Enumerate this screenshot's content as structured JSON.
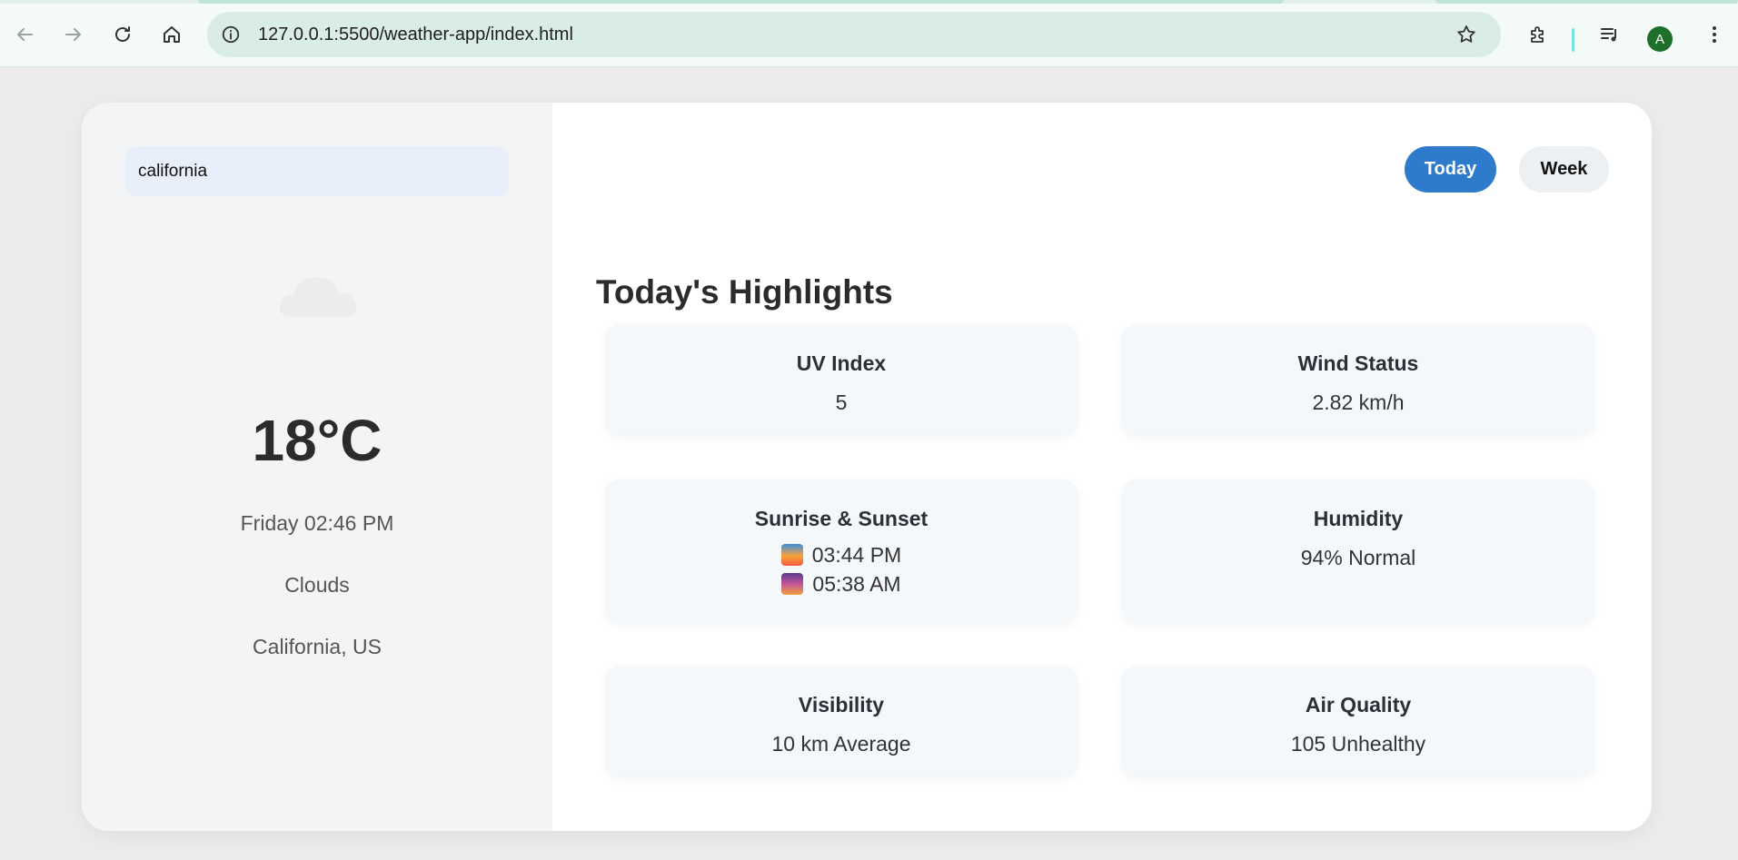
{
  "browser": {
    "url": "127.0.0.1:5500/weather-app/index.html",
    "avatar_letter": "A"
  },
  "sidebar": {
    "search_value": "california",
    "weather_icon": "cloud-icon",
    "temperature": "18°C",
    "datetime": "Friday 02:46 PM",
    "condition": "Clouds",
    "location": "California, US"
  },
  "toggles": {
    "today": "Today",
    "week": "Week"
  },
  "highlights": {
    "title": "Today's Highlights",
    "uv": {
      "label": "UV Index",
      "value": "5"
    },
    "wind": {
      "label": "Wind Status",
      "value": "2.82 km/h"
    },
    "sun": {
      "label": "Sunrise & Sunset",
      "sunrise": "03:44 PM",
      "sunset": "05:38 AM"
    },
    "humidity": {
      "label": "Humidity",
      "value": "94% Normal"
    },
    "visibility": {
      "label": "Visibility",
      "value": "10 km Average"
    },
    "air": {
      "label": "Air Quality",
      "value": "105 Unhealthy"
    }
  },
  "colors": {
    "accent": "#2f7bcb",
    "card_bg": "#f5f8fb",
    "sidebar_bg": "#f3f4f6"
  }
}
